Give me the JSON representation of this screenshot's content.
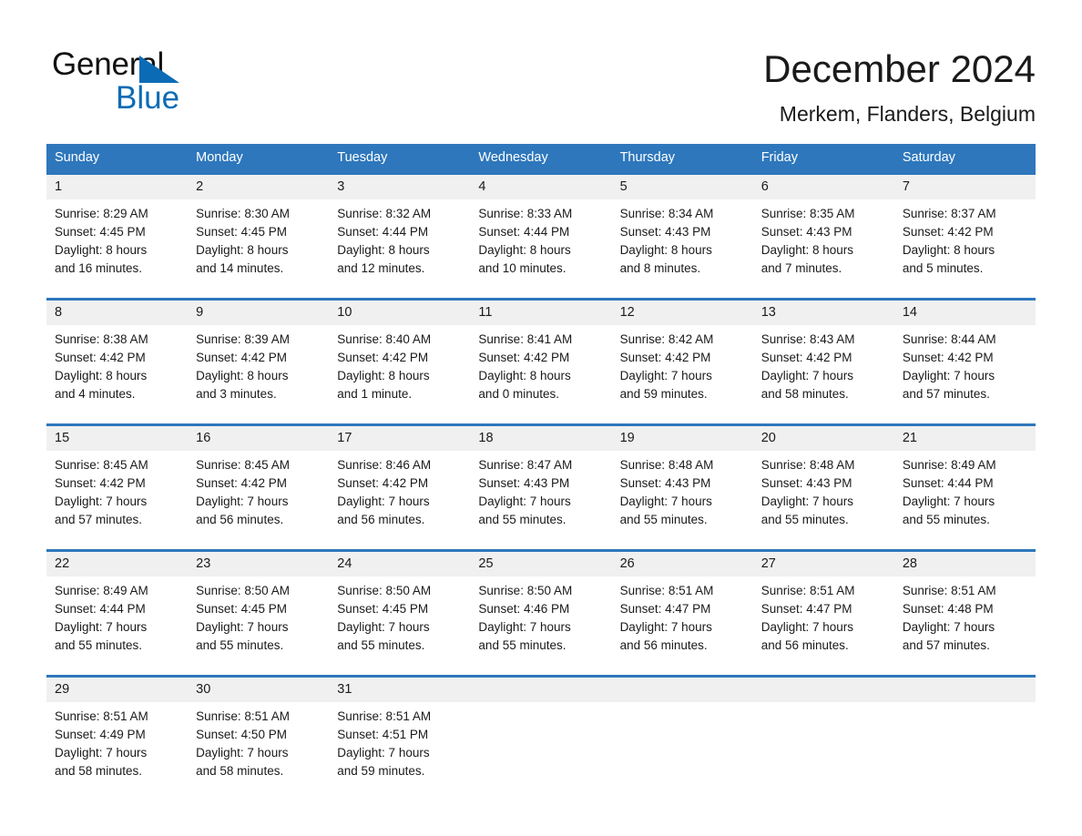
{
  "brand": {
    "word_general": "General",
    "word_blue": "Blue",
    "triangle_color": "#0b6cb5",
    "logo_icon": "triangle-icon"
  },
  "header": {
    "title": "December 2024",
    "subtitle": "Merkem, Flanders, Belgium"
  },
  "theme": {
    "header_blue": "#2e77bc",
    "date_band_gray": "#f0f0f0",
    "text_color": "#1a1a1a",
    "page_background": "#ffffff"
  },
  "weekdays": [
    "Sunday",
    "Monday",
    "Tuesday",
    "Wednesday",
    "Thursday",
    "Friday",
    "Saturday"
  ],
  "weeks": [
    {
      "days": [
        {
          "date": "1",
          "sunrise": "Sunrise: 8:29 AM",
          "sunset": "Sunset: 4:45 PM",
          "daylight_1": "Daylight: 8 hours",
          "daylight_2": "and 16 minutes."
        },
        {
          "date": "2",
          "sunrise": "Sunrise: 8:30 AM",
          "sunset": "Sunset: 4:45 PM",
          "daylight_1": "Daylight: 8 hours",
          "daylight_2": "and 14 minutes."
        },
        {
          "date": "3",
          "sunrise": "Sunrise: 8:32 AM",
          "sunset": "Sunset: 4:44 PM",
          "daylight_1": "Daylight: 8 hours",
          "daylight_2": "and 12 minutes."
        },
        {
          "date": "4",
          "sunrise": "Sunrise: 8:33 AM",
          "sunset": "Sunset: 4:44 PM",
          "daylight_1": "Daylight: 8 hours",
          "daylight_2": "and 10 minutes."
        },
        {
          "date": "5",
          "sunrise": "Sunrise: 8:34 AM",
          "sunset": "Sunset: 4:43 PM",
          "daylight_1": "Daylight: 8 hours",
          "daylight_2": "and 8 minutes."
        },
        {
          "date": "6",
          "sunrise": "Sunrise: 8:35 AM",
          "sunset": "Sunset: 4:43 PM",
          "daylight_1": "Daylight: 8 hours",
          "daylight_2": "and 7 minutes."
        },
        {
          "date": "7",
          "sunrise": "Sunrise: 8:37 AM",
          "sunset": "Sunset: 4:42 PM",
          "daylight_1": "Daylight: 8 hours",
          "daylight_2": "and 5 minutes."
        }
      ]
    },
    {
      "days": [
        {
          "date": "8",
          "sunrise": "Sunrise: 8:38 AM",
          "sunset": "Sunset: 4:42 PM",
          "daylight_1": "Daylight: 8 hours",
          "daylight_2": "and 4 minutes."
        },
        {
          "date": "9",
          "sunrise": "Sunrise: 8:39 AM",
          "sunset": "Sunset: 4:42 PM",
          "daylight_1": "Daylight: 8 hours",
          "daylight_2": "and 3 minutes."
        },
        {
          "date": "10",
          "sunrise": "Sunrise: 8:40 AM",
          "sunset": "Sunset: 4:42 PM",
          "daylight_1": "Daylight: 8 hours",
          "daylight_2": "and 1 minute."
        },
        {
          "date": "11",
          "sunrise": "Sunrise: 8:41 AM",
          "sunset": "Sunset: 4:42 PM",
          "daylight_1": "Daylight: 8 hours",
          "daylight_2": "and 0 minutes."
        },
        {
          "date": "12",
          "sunrise": "Sunrise: 8:42 AM",
          "sunset": "Sunset: 4:42 PM",
          "daylight_1": "Daylight: 7 hours",
          "daylight_2": "and 59 minutes."
        },
        {
          "date": "13",
          "sunrise": "Sunrise: 8:43 AM",
          "sunset": "Sunset: 4:42 PM",
          "daylight_1": "Daylight: 7 hours",
          "daylight_2": "and 58 minutes."
        },
        {
          "date": "14",
          "sunrise": "Sunrise: 8:44 AM",
          "sunset": "Sunset: 4:42 PM",
          "daylight_1": "Daylight: 7 hours",
          "daylight_2": "and 57 minutes."
        }
      ]
    },
    {
      "days": [
        {
          "date": "15",
          "sunrise": "Sunrise: 8:45 AM",
          "sunset": "Sunset: 4:42 PM",
          "daylight_1": "Daylight: 7 hours",
          "daylight_2": "and 57 minutes."
        },
        {
          "date": "16",
          "sunrise": "Sunrise: 8:45 AM",
          "sunset": "Sunset: 4:42 PM",
          "daylight_1": "Daylight: 7 hours",
          "daylight_2": "and 56 minutes."
        },
        {
          "date": "17",
          "sunrise": "Sunrise: 8:46 AM",
          "sunset": "Sunset: 4:42 PM",
          "daylight_1": "Daylight: 7 hours",
          "daylight_2": "and 56 minutes."
        },
        {
          "date": "18",
          "sunrise": "Sunrise: 8:47 AM",
          "sunset": "Sunset: 4:43 PM",
          "daylight_1": "Daylight: 7 hours",
          "daylight_2": "and 55 minutes."
        },
        {
          "date": "19",
          "sunrise": "Sunrise: 8:48 AM",
          "sunset": "Sunset: 4:43 PM",
          "daylight_1": "Daylight: 7 hours",
          "daylight_2": "and 55 minutes."
        },
        {
          "date": "20",
          "sunrise": "Sunrise: 8:48 AM",
          "sunset": "Sunset: 4:43 PM",
          "daylight_1": "Daylight: 7 hours",
          "daylight_2": "and 55 minutes."
        },
        {
          "date": "21",
          "sunrise": "Sunrise: 8:49 AM",
          "sunset": "Sunset: 4:44 PM",
          "daylight_1": "Daylight: 7 hours",
          "daylight_2": "and 55 minutes."
        }
      ]
    },
    {
      "days": [
        {
          "date": "22",
          "sunrise": "Sunrise: 8:49 AM",
          "sunset": "Sunset: 4:44 PM",
          "daylight_1": "Daylight: 7 hours",
          "daylight_2": "and 55 minutes."
        },
        {
          "date": "23",
          "sunrise": "Sunrise: 8:50 AM",
          "sunset": "Sunset: 4:45 PM",
          "daylight_1": "Daylight: 7 hours",
          "daylight_2": "and 55 minutes."
        },
        {
          "date": "24",
          "sunrise": "Sunrise: 8:50 AM",
          "sunset": "Sunset: 4:45 PM",
          "daylight_1": "Daylight: 7 hours",
          "daylight_2": "and 55 minutes."
        },
        {
          "date": "25",
          "sunrise": "Sunrise: 8:50 AM",
          "sunset": "Sunset: 4:46 PM",
          "daylight_1": "Daylight: 7 hours",
          "daylight_2": "and 55 minutes."
        },
        {
          "date": "26",
          "sunrise": "Sunrise: 8:51 AM",
          "sunset": "Sunset: 4:47 PM",
          "daylight_1": "Daylight: 7 hours",
          "daylight_2": "and 56 minutes."
        },
        {
          "date": "27",
          "sunrise": "Sunrise: 8:51 AM",
          "sunset": "Sunset: 4:47 PM",
          "daylight_1": "Daylight: 7 hours",
          "daylight_2": "and 56 minutes."
        },
        {
          "date": "28",
          "sunrise": "Sunrise: 8:51 AM",
          "sunset": "Sunset: 4:48 PM",
          "daylight_1": "Daylight: 7 hours",
          "daylight_2": "and 57 minutes."
        }
      ]
    },
    {
      "days": [
        {
          "date": "29",
          "sunrise": "Sunrise: 8:51 AM",
          "sunset": "Sunset: 4:49 PM",
          "daylight_1": "Daylight: 7 hours",
          "daylight_2": "and 58 minutes."
        },
        {
          "date": "30",
          "sunrise": "Sunrise: 8:51 AM",
          "sunset": "Sunset: 4:50 PM",
          "daylight_1": "Daylight: 7 hours",
          "daylight_2": "and 58 minutes."
        },
        {
          "date": "31",
          "sunrise": "Sunrise: 8:51 AM",
          "sunset": "Sunset: 4:51 PM",
          "daylight_1": "Daylight: 7 hours",
          "daylight_2": "and 59 minutes."
        },
        {
          "date": "",
          "sunrise": "",
          "sunset": "",
          "daylight_1": "",
          "daylight_2": ""
        },
        {
          "date": "",
          "sunrise": "",
          "sunset": "",
          "daylight_1": "",
          "daylight_2": ""
        },
        {
          "date": "",
          "sunrise": "",
          "sunset": "",
          "daylight_1": "",
          "daylight_2": ""
        },
        {
          "date": "",
          "sunrise": "",
          "sunset": "",
          "daylight_1": "",
          "daylight_2": ""
        }
      ]
    }
  ]
}
